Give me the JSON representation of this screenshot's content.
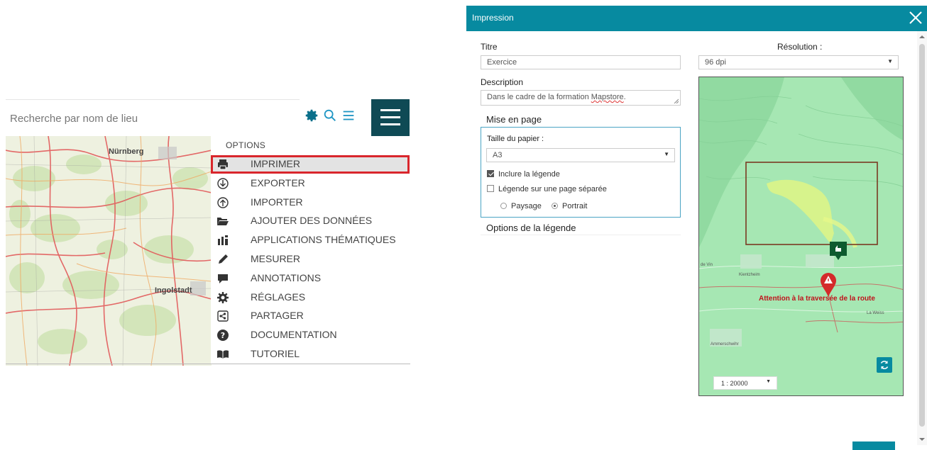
{
  "search": {
    "placeholder": "Recherche par nom de lieu"
  },
  "map_labels": {
    "city1": "Nürnberg",
    "city2": "Ingolstadt"
  },
  "menu": {
    "heading": "OPTIONS",
    "items": [
      {
        "label": "IMPRIMER",
        "icon": "printer-icon"
      },
      {
        "label": "EXPORTER",
        "icon": "download-circle-icon"
      },
      {
        "label": "IMPORTER",
        "icon": "upload-circle-icon"
      },
      {
        "label": "AJOUTER DES DONNÉES",
        "icon": "folder-open-icon"
      },
      {
        "label": "APPLICATIONS THÉMATIQUES",
        "icon": "dashboard-icon"
      },
      {
        "label": "MESURER",
        "icon": "pencil-icon"
      },
      {
        "label": "ANNOTATIONS",
        "icon": "comment-icon"
      },
      {
        "label": "RÉGLAGES",
        "icon": "gear-icon"
      },
      {
        "label": "PARTAGER",
        "icon": "share-icon"
      },
      {
        "label": "DOCUMENTATION",
        "icon": "question-circle-icon"
      },
      {
        "label": "TUTORIEL",
        "icon": "book-icon"
      }
    ]
  },
  "dialog": {
    "title": "Impression",
    "title_label": "Titre",
    "title_value": "Exercice",
    "description_label": "Description",
    "description_value_prefix": "Dans le cadre de la formation ",
    "description_value_word": "Mapstore",
    "description_value_suffix": ".",
    "resolution_label": "Résolution :",
    "resolution_value": "96 dpi",
    "layout_heading": "Mise en page",
    "paper_label": "Taille du papier :",
    "paper_value": "A3",
    "include_legend_label": "Inclure la légende",
    "include_legend_checked": true,
    "separate_legend_label": "Légende sur une page séparée",
    "separate_legend_checked": false,
    "orientation_landscape": "Paysage",
    "orientation_portrait": "Portrait",
    "orientation_selected": "Portrait",
    "legend_options_label": "Options de la légende",
    "scale_value": "1 : 20000",
    "road_warning": "Attention à la traversée de la route",
    "preview_place_labels": {
      "a": "Kientzheim",
      "b": "Ammerschwihr",
      "c": "La Weiss",
      "d": "de Vin"
    }
  },
  "colors": {
    "header": "#078aa0",
    "burger": "#0f4a55",
    "highlight_border": "#d9262c",
    "map_green": "#a6e7b3"
  }
}
